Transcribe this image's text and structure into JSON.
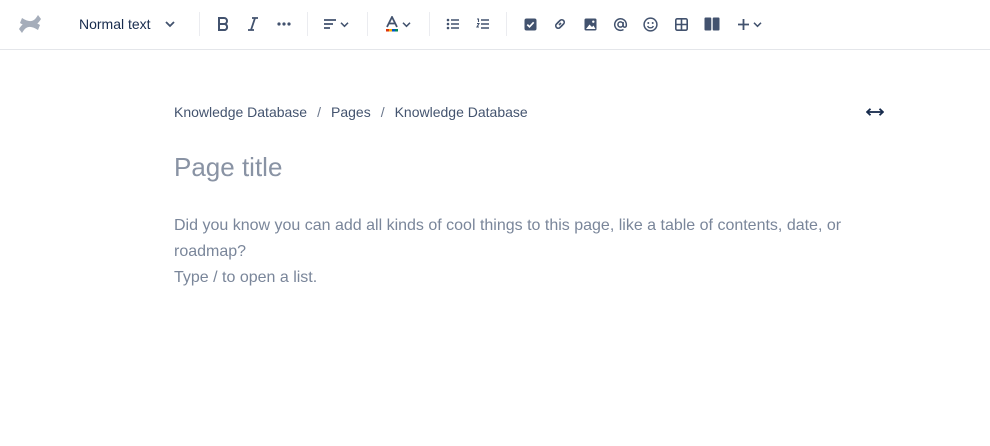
{
  "toolbar": {
    "text_style": "Normal text",
    "items": {
      "bold": "bold-icon",
      "italic": "italic-icon",
      "more_formatting": "more-icon",
      "alignment": "align-left-icon",
      "text_color": "text-color-icon",
      "bullet_list": "bullet-list-icon",
      "numbered_list": "numbered-list-icon",
      "action_item": "checkbox-icon",
      "link": "link-icon",
      "image": "image-icon",
      "mention": "mention-icon",
      "emoji": "emoji-icon",
      "table": "table-icon",
      "layouts": "layout-icon",
      "insert": "plus-icon"
    },
    "colors": {
      "icon": "#42526e",
      "text_color_bar": [
        "#de350b",
        "#ffab00",
        "#0052cc",
        "#00875a"
      ]
    }
  },
  "breadcrumbs": {
    "items": [
      "Knowledge Database",
      "Pages",
      "Knowledge Database"
    ],
    "separator": "/"
  },
  "editor": {
    "title_placeholder": "Page title",
    "body_placeholder_line1": "Did you know you can add all kinds of cool things to this page, like a table of contents, date, or roadmap?",
    "body_placeholder_line2": "Type / to open a list."
  }
}
